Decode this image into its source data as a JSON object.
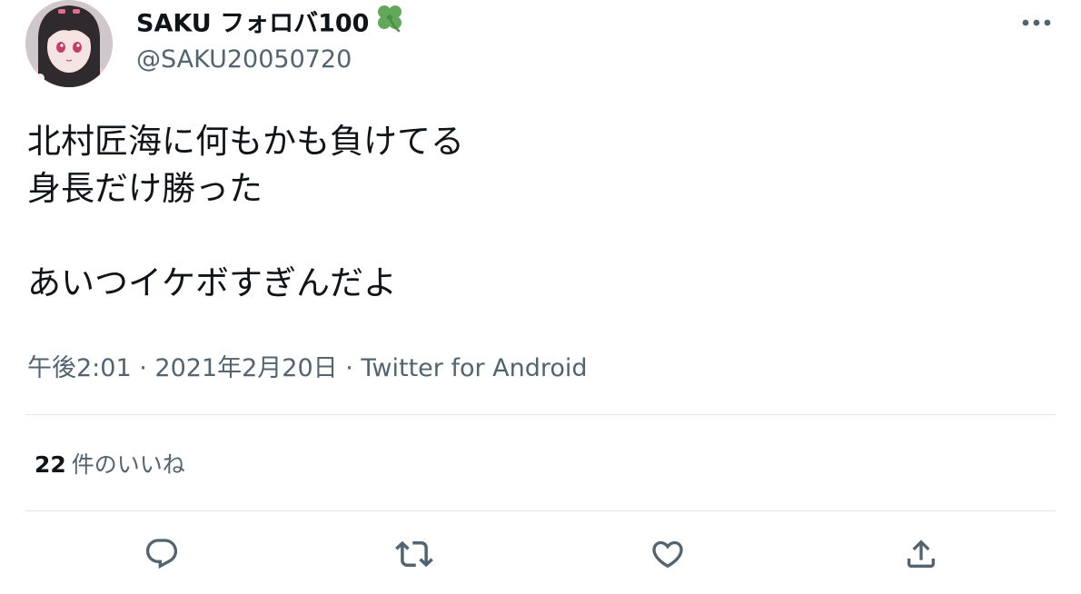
{
  "user": {
    "display_name": "SAKU フォロバ100",
    "name_emoji_icon": "four-leaf-clover-icon",
    "handle": "@SAKU20050720"
  },
  "tweet": {
    "lines": [
      "北村匠海に何もかも負けてる",
      "身長だけ勝った",
      "",
      "あいつイケボすぎんだよ"
    ],
    "time": "午後2:01",
    "date": "2021年2月20日",
    "separator": " · ",
    "source": "Twitter for Android"
  },
  "stats": {
    "likes_count": "22",
    "likes_label": "件のいいね"
  },
  "actions": {
    "reply_icon": "reply-icon",
    "retweet_icon": "retweet-icon",
    "like_icon": "heart-icon",
    "share_icon": "share-icon",
    "more_icon": "more-icon"
  },
  "colors": {
    "text_primary": "#0f1419",
    "text_secondary": "#536471",
    "divider": "#e4e8eb",
    "clover_green": "#62a85a"
  }
}
